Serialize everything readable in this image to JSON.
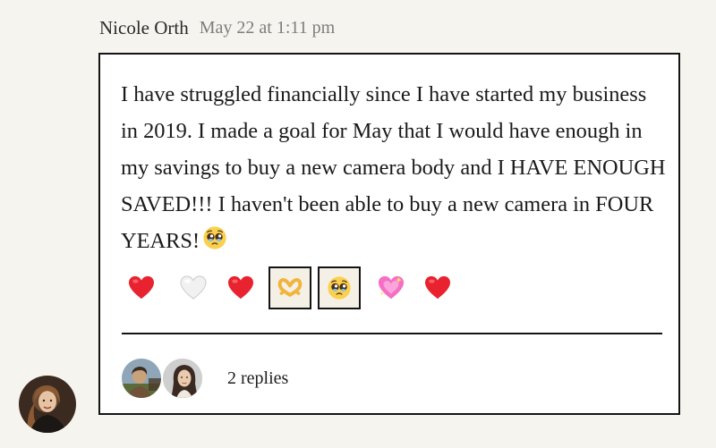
{
  "post": {
    "author": "Nicole Orth",
    "timestamp": "May 22 at 1:11 pm",
    "avatar": "woman-with-long-hair-photo",
    "message": "I have struggled financially since I have started my business in 2019. I made a goal for May that I would have enough in my savings to buy a new camera body and I HAVE ENOUGH SAVED!!! I haven't been able to buy a new camera in FOUR YEARS!",
    "message_emoji": "pleading-face-icon"
  },
  "reactions": [
    {
      "icon": "red-heart-icon",
      "selected": false
    },
    {
      "icon": "white-heart-icon",
      "selected": false
    },
    {
      "icon": "red-heart-icon",
      "selected": false
    },
    {
      "icon": "heart-hands-icon",
      "selected": true
    },
    {
      "icon": "pleading-face-icon",
      "selected": true
    },
    {
      "icon": "sparkling-heart-icon",
      "selected": false
    },
    {
      "icon": "red-heart-icon",
      "selected": false
    }
  ],
  "replies": {
    "count_label": "2 replies",
    "avatars": [
      "person-outdoors-photo",
      "woman-portrait-photo"
    ]
  },
  "colors": {
    "page_background": "#f6f4ef",
    "card_background": "#ffffff",
    "border": "#141414",
    "timestamp_text": "#7d7d7d",
    "selected_reaction_background": "#f4f0e6"
  }
}
